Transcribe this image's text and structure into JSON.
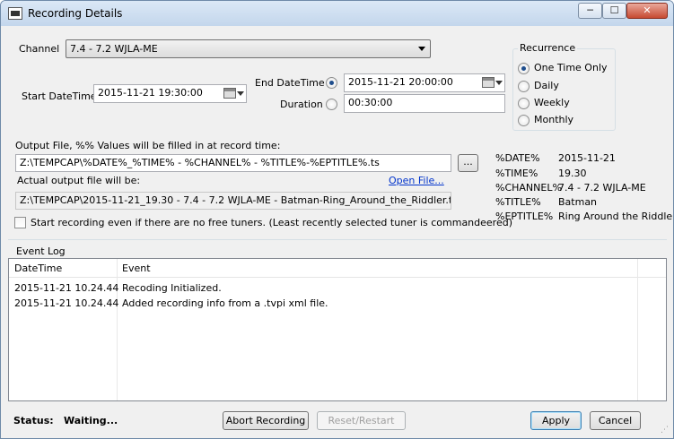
{
  "window": {
    "title": "Recording Details",
    "minimize_glyph": "─",
    "maximize_glyph": "☐",
    "close_glyph": "✕"
  },
  "channel": {
    "label": "Channel",
    "value": "7.4 - 7.2 WJLA-ME"
  },
  "start": {
    "label": "Start DateTime",
    "value": "2015-11-21 19:30:00"
  },
  "end": {
    "label": "End DateTime",
    "value": "2015-11-21 20:00:00",
    "selected": true
  },
  "duration": {
    "label": "Duration",
    "value": "00:30:00",
    "selected": false
  },
  "recurrence": {
    "title": "Recurrence",
    "options": [
      {
        "label": "One Time Only",
        "selected": true
      },
      {
        "label": "Daily",
        "selected": false
      },
      {
        "label": "Weekly",
        "selected": false
      },
      {
        "label": "Monthly",
        "selected": false
      }
    ]
  },
  "output": {
    "label": "Output File, %% Values will be filled in at record time:",
    "value": "Z:\\TEMPCAP\\%DATE%_%TIME% - %CHANNEL% - %TITLE%-%EPTITLE%.ts",
    "browse_label": "...",
    "actual_label": "Actual output file will be:",
    "open_file_label": "Open File...",
    "actual_value": "Z:\\TEMPCAP\\2015-11-21_19.30 - 7.4 - 7.2 WJLA-ME - Batman-Ring_Around_the_Riddler.ts"
  },
  "tuner": {
    "label": "Start recording even if there are no free tuners. (Least recently selected tuner is commandeered)",
    "checked": false
  },
  "variables": [
    {
      "key": "%DATE%",
      "value": "2015-11-21"
    },
    {
      "key": "%TIME%",
      "value": "19.30"
    },
    {
      "key": "%CHANNEL%",
      "value": "7.4 - 7.2 WJLA-ME"
    },
    {
      "key": "%TITLE%",
      "value": "Batman"
    },
    {
      "key": "%EPTITLE%",
      "value": "Ring Around the Riddler"
    }
  ],
  "event_log": {
    "title": "Event Log",
    "columns": [
      "DateTime",
      "Event"
    ],
    "rows": [
      {
        "datetime": "2015-11-21 10.24.44",
        "event": "Recoding Initialized."
      },
      {
        "datetime": "2015-11-21 10.24.44",
        "event": "Added recording info from a .tvpi xml file."
      }
    ]
  },
  "status": {
    "label": "Status:",
    "value": "Waiting..."
  },
  "buttons": {
    "abort": "Abort Recording",
    "reset": "Reset/Restart",
    "apply": "Apply",
    "cancel": "Cancel"
  }
}
